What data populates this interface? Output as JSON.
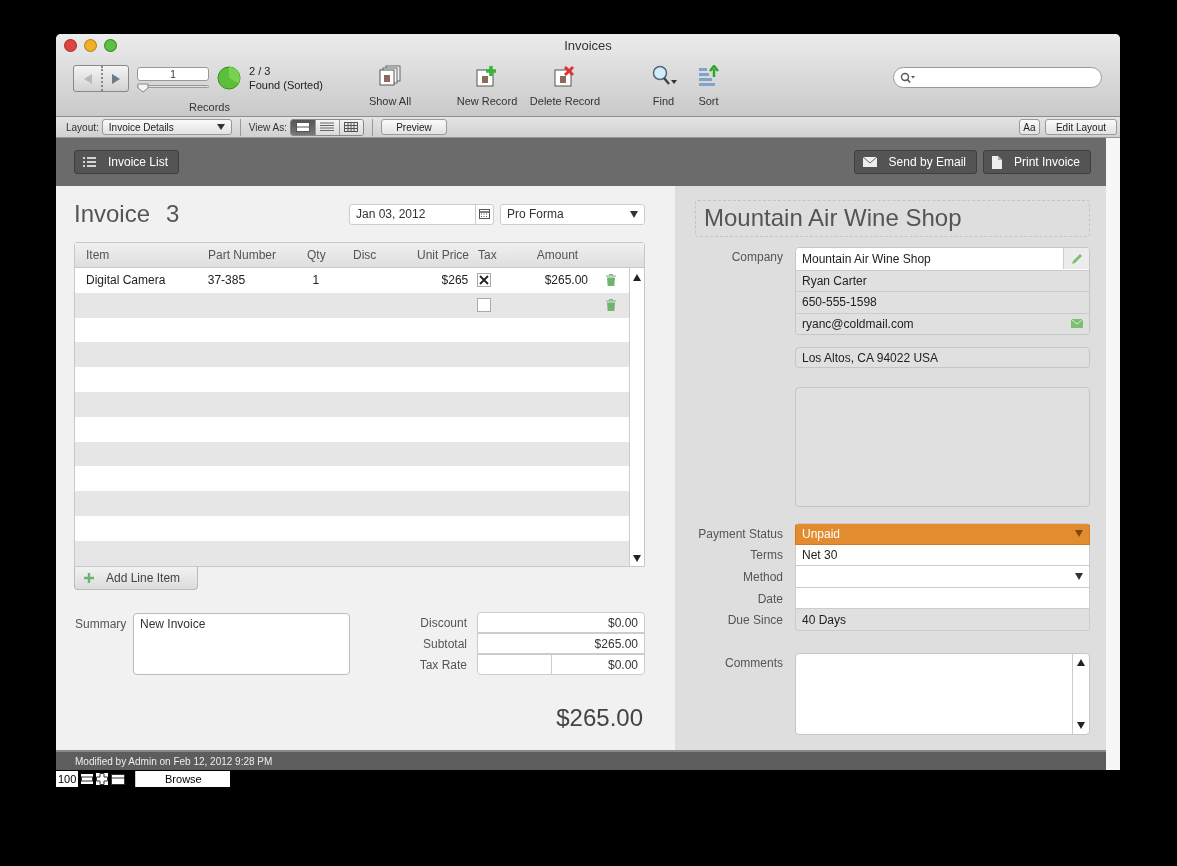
{
  "window": {
    "title": "Invoices"
  },
  "toolbar": {
    "record_number": "1",
    "record_slider": {
      "level": 0
    },
    "found_count": "2 / 3",
    "found_status": "Found (Sorted)",
    "records_label": "Records",
    "tools": [
      {
        "kind": "show_all",
        "label": "Show All"
      },
      {
        "kind": "new_record",
        "label": "New Record"
      },
      {
        "kind": "delete_record",
        "label": "Delete Record"
      },
      {
        "kind": "find",
        "label": "Find"
      },
      {
        "kind": "sort",
        "label": "Sort"
      }
    ]
  },
  "layout_bar": {
    "layout_label": "Layout:",
    "layout_value": "Invoice Details",
    "view_as_label": "View As:",
    "view_modes": [
      {
        "kind": "form",
        "selected": true
      },
      {
        "kind": "list",
        "selected": false
      },
      {
        "kind": "table",
        "selected": false
      }
    ],
    "preview_button": "Preview",
    "font_button": "Aa",
    "edit_layout_button": "Edit Layout"
  },
  "header": {
    "invoice_list_button": "Invoice List",
    "send_email_button": "Send by Email",
    "print_button": "Print Invoice"
  },
  "invoice": {
    "title": "Invoice",
    "number": "3",
    "date": "Jan 03, 2012",
    "type": "Pro Forma"
  },
  "line_items": {
    "columns": [
      "Item",
      "Part Number",
      "Qty",
      "Disc",
      "Unit Price",
      "Tax",
      "Amount"
    ],
    "rows": [
      {
        "item": "Digital Camera",
        "part_number": "37-385",
        "qty": "1",
        "unit_price": "$265",
        "tax": true,
        "amount": "$265.00"
      },
      {
        "tax": false
      }
    ],
    "add_button": "Add Line Item"
  },
  "summary": {
    "label": "Summary",
    "value": "New Invoice"
  },
  "totals": [
    {
      "kind": "single",
      "label": "Discount",
      "value": "$0.00"
    },
    {
      "kind": "single",
      "label": "Subtotal",
      "value": "$265.00"
    },
    {
      "kind": "split",
      "label": "Tax Rate",
      "value": "$0.00"
    }
  ],
  "grand_total": "$265.00",
  "customer": {
    "name": "Mountain Air Wine Shop",
    "contact_label": "Company",
    "contact": [
      {
        "kind": "company",
        "value": "Mountain Air Wine Shop"
      },
      {
        "kind": "name",
        "value": "Ryan Carter"
      },
      {
        "kind": "phone",
        "value": "650-555-1598"
      },
      {
        "kind": "email",
        "value": "ryanc@coldmail.com"
      }
    ],
    "address": "Los Altos, CA 94022 USA"
  },
  "payment": [
    {
      "kind": "status",
      "label": "Payment Status",
      "value": "Unpaid"
    },
    {
      "kind": "text",
      "label": "Terms",
      "value": "Net 30"
    },
    {
      "kind": "dropdown",
      "label": "Method"
    },
    {
      "kind": "text",
      "label": "Date"
    },
    {
      "kind": "readonly",
      "label": "Due Since",
      "value": "40 Days"
    }
  ],
  "comments_label": "Comments",
  "status_bar": "Modified by Admin on Feb 12, 2012 9:28 PM",
  "bottom_bar": {
    "zoom": "100",
    "mode": "Browse"
  }
}
